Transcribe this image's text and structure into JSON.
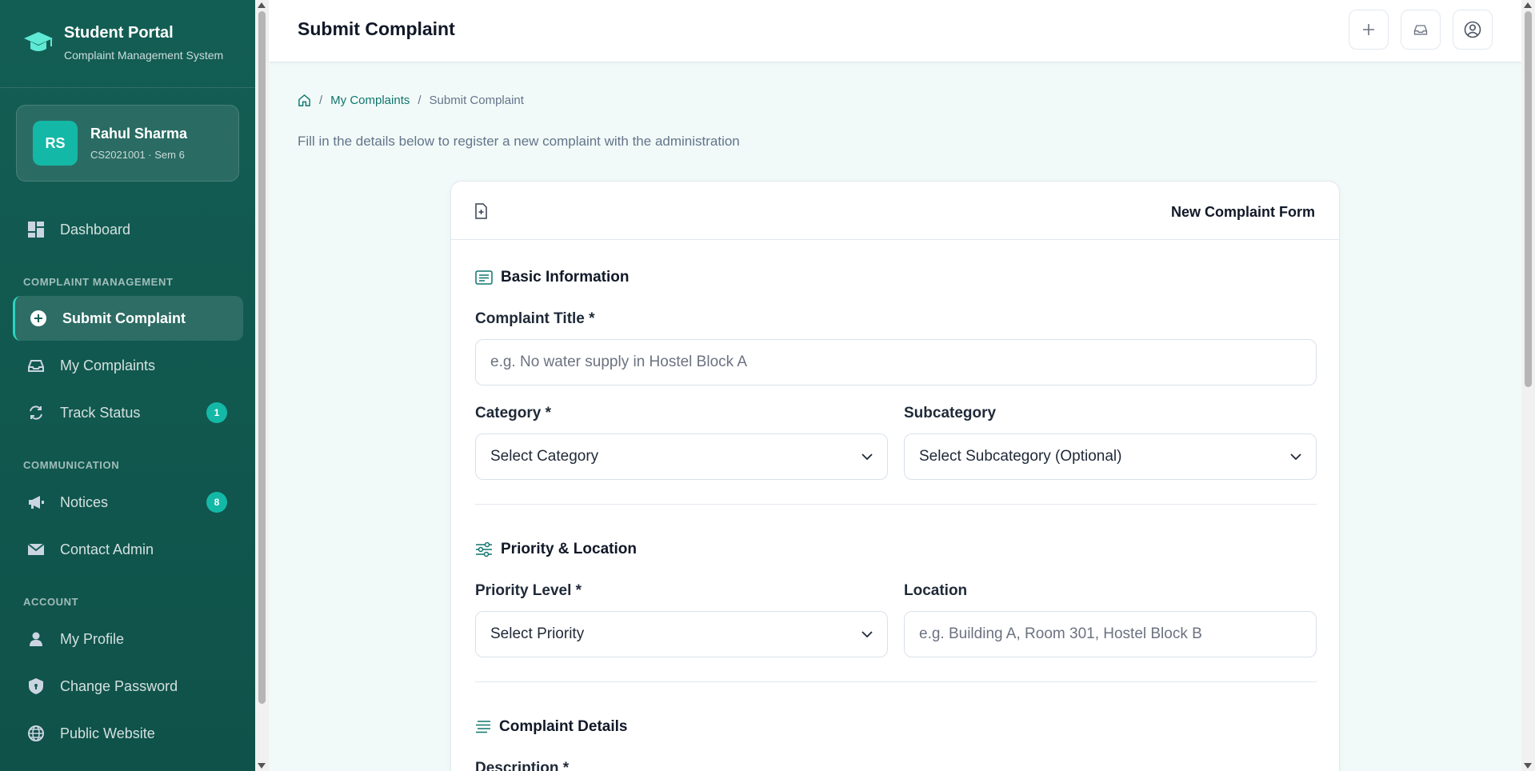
{
  "brand": {
    "title": "Student Portal",
    "subtitle": "Complaint Management System"
  },
  "user": {
    "initials": "RS",
    "name": "Rahul Sharma",
    "meta": "CS2021001 · Sem 6"
  },
  "nav": {
    "dashboard": "Dashboard",
    "section_complaints": "COMPLAINT MANAGEMENT",
    "submit": "Submit Complaint",
    "my_complaints": "My Complaints",
    "track": "Track Status",
    "track_badge": "1",
    "section_comm": "COMMUNICATION",
    "notices": "Notices",
    "notices_badge": "8",
    "contact": "Contact Admin",
    "section_account": "ACCOUNT",
    "profile": "My Profile",
    "password": "Change Password",
    "website": "Public Website"
  },
  "header": {
    "title": "Submit Complaint"
  },
  "breadcrumb": {
    "sep": "/",
    "parent": "My Complaints",
    "current": "Submit Complaint"
  },
  "intro": "Fill in the details below to register a new complaint with the administration",
  "form": {
    "card_title": "New Complaint Form",
    "basic": "Basic Information",
    "title_label": "Complaint Title *",
    "title_placeholder": "e.g. No water supply in Hostel Block A",
    "category_label": "Category *",
    "category_value": "Select Category",
    "subcategory_label": "Subcategory",
    "subcategory_value": "Select Subcategory (Optional)",
    "priority_section": "Priority & Location",
    "priority_label": "Priority Level *",
    "priority_value": "Select Priority",
    "location_label": "Location",
    "location_placeholder": "e.g. Building A, Room 301, Hostel Block B",
    "details_section": "Complaint Details",
    "description_label": "Description *"
  },
  "colors": {
    "sidebar": "#135e54",
    "accent": "#14b8a6",
    "link": "#0f766e"
  }
}
